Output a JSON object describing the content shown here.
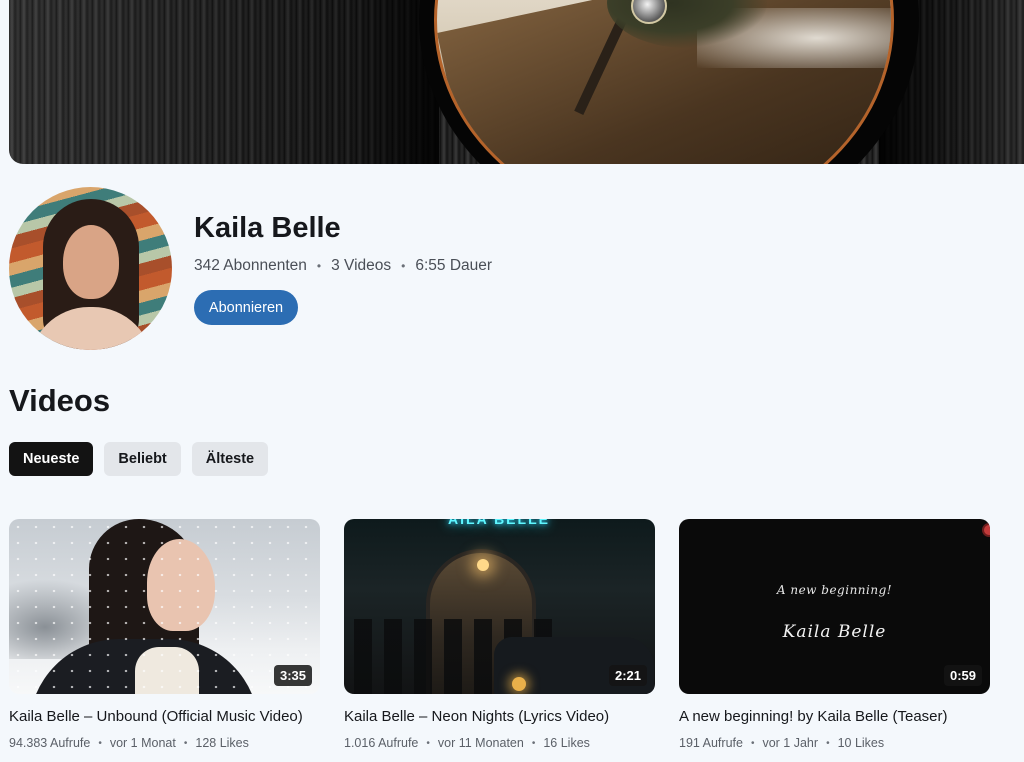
{
  "channel": {
    "name": "Kaila Belle",
    "subscribers": "342 Abonnenten",
    "video_count": "3 Videos",
    "duration": "6:55 Dauer",
    "meta_separator": "•",
    "subscribe_label": "Abonnieren"
  },
  "videos_section": {
    "title": "Videos",
    "filters": [
      {
        "label": "Neueste",
        "active": true
      },
      {
        "label": "Beliebt",
        "active": false
      },
      {
        "label": "Älteste",
        "active": false
      }
    ]
  },
  "videos": [
    {
      "title": "Kaila Belle – Unbound (Official Music Video)",
      "duration": "3:35",
      "views": "94.383 Aufrufe",
      "age": "vor 1 Monat",
      "likes": "128 Likes"
    },
    {
      "title": "Kaila Belle – Neon Nights (Lyrics Video)",
      "duration": "2:21",
      "views": "1.016 Aufrufe",
      "age": "vor 11 Monaten",
      "likes": "16 Likes",
      "thumbnail_sign": "AILA BELLE"
    },
    {
      "title": "A new beginning! by Kaila Belle (Teaser)",
      "duration": "0:59",
      "views": "191 Aufrufe",
      "age": "vor 1 Jahr",
      "likes": "10 Likes",
      "thumbnail_text_1": "A new beginning!",
      "thumbnail_text_2": "Kaila Belle"
    }
  ],
  "colors": {
    "background": "#f4f8fc",
    "accent": "#2c6db3",
    "active_chip": "#131313",
    "chip": "#e3e6ea"
  }
}
